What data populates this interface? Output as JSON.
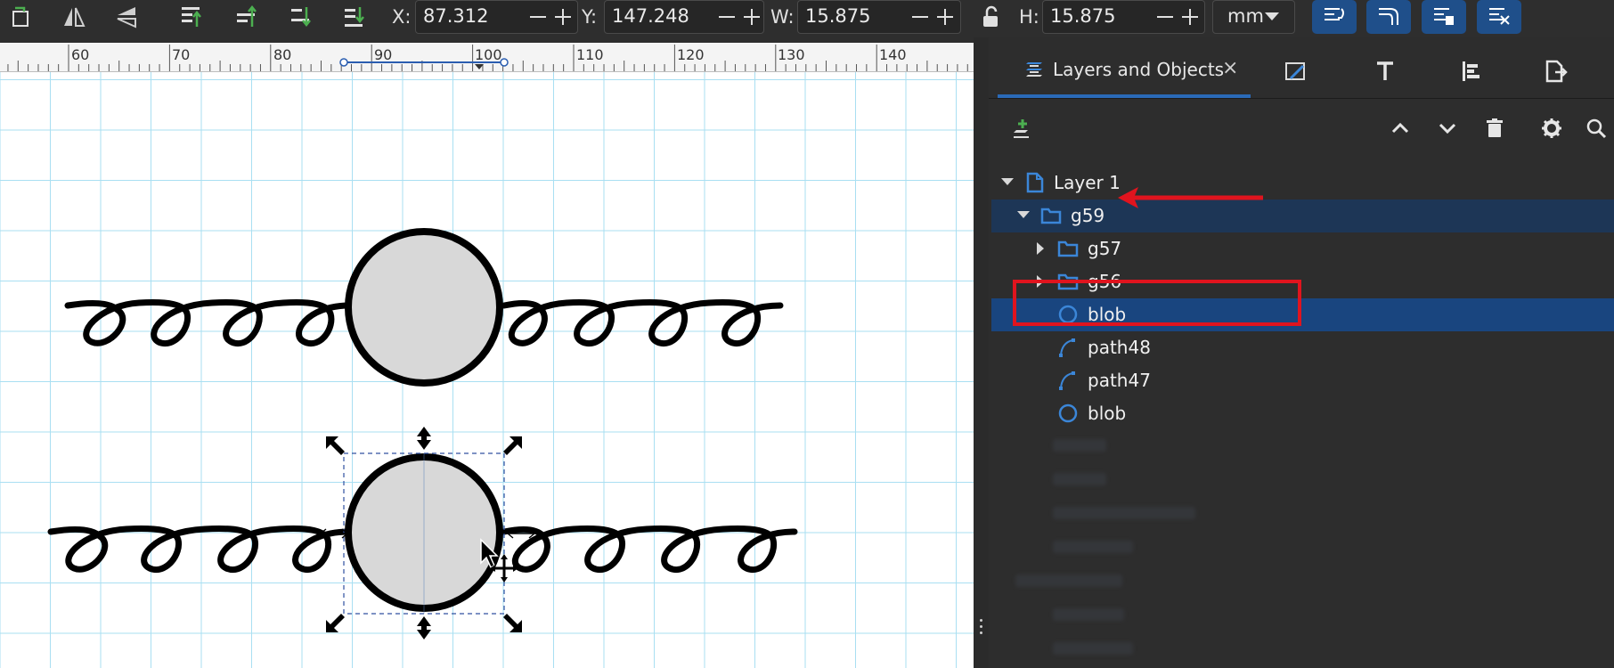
{
  "toolbar": {
    "x_label": "X:",
    "x_value": "87.312",
    "y_label": "Y:",
    "y_value": "147.248",
    "w_label": "W:",
    "w_value": "15.875",
    "h_label": "H:",
    "h_value": "15.875",
    "unit": "mm",
    "icons": [
      "select-all-icon",
      "flip-horizontal-icon",
      "flip-vertical-icon",
      "raise-to-top-icon",
      "raise-icon",
      "lower-icon",
      "lower-to-bottom-icon",
      "lock-icon"
    ]
  },
  "ruler": {
    "labels": [
      "60",
      "70",
      "80",
      "90",
      "100",
      "110",
      "120",
      "130",
      "140"
    ]
  },
  "panel": {
    "active_tab": "Layers and Objects",
    "close_glyph": "×",
    "tabs_icons": [
      "fill-stroke-icon",
      "text-icon",
      "align-icon",
      "export-icon"
    ],
    "tree": [
      {
        "label": "Layer 1",
        "type": "layer",
        "expanded": true,
        "depth": 0
      },
      {
        "label": "g59",
        "type": "group",
        "expanded": true,
        "depth": 1,
        "selected": "parent"
      },
      {
        "label": "g57",
        "type": "group",
        "expanded": false,
        "depth": 2
      },
      {
        "label": "g56",
        "type": "group",
        "expanded": false,
        "depth": 2
      },
      {
        "label": "blob",
        "type": "circle",
        "depth": 2,
        "selected": "current"
      },
      {
        "label": "path48",
        "type": "path",
        "depth": 2
      },
      {
        "label": "path47",
        "type": "path",
        "depth": 2
      },
      {
        "label": "blob",
        "type": "circle",
        "depth": 2
      }
    ]
  },
  "colors": {
    "accent": "#2a6ab8",
    "selection": "#19457f",
    "annotation": "#e0141e"
  }
}
